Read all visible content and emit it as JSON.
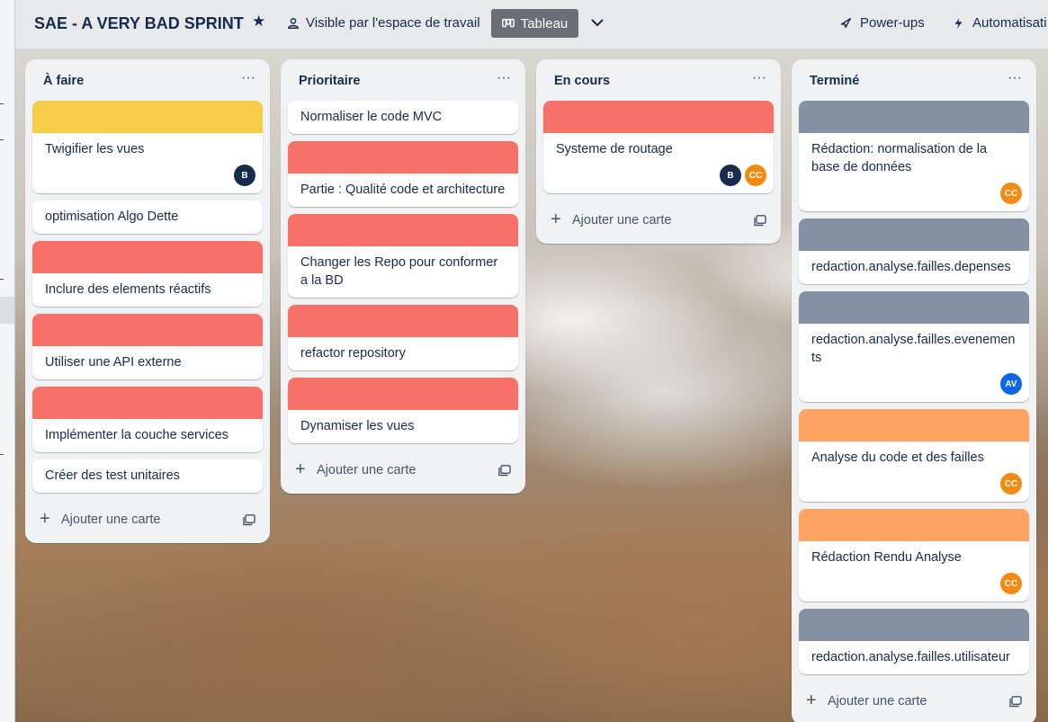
{
  "header": {
    "title": "SAE - A VERY BAD SPRINT",
    "visibility": "Visible par l'espace de travail",
    "view": "Tableau",
    "powerups": "Power-ups",
    "automation": "Automatisati"
  },
  "colors": {
    "yellow": "#f5cd47",
    "red": "#f87168",
    "gray": "#8590a2",
    "orange": "#fea362",
    "avatar_b": "#172b4d",
    "avatar_cc": "#f38a12",
    "avatar_av": "#0c66e4"
  },
  "add_card_label": "Ajouter une carte",
  "lists": [
    {
      "title": "À faire",
      "cards": [
        {
          "title": "Twigifier les vues",
          "cover": "yellow",
          "members": [
            "B"
          ]
        },
        {
          "title": "optimisation Algo Dette",
          "cover": "",
          "members": []
        },
        {
          "title": "Inclure des elements réactifs",
          "cover": "red",
          "members": []
        },
        {
          "title": "Utiliser une API externe",
          "cover": "red",
          "members": []
        },
        {
          "title": "Implémenter la couche services",
          "cover": "red",
          "members": []
        },
        {
          "title": "Créer des test unitaires",
          "cover": "",
          "members": []
        }
      ]
    },
    {
      "title": "Prioritaire",
      "cards": [
        {
          "title": "Normaliser le code MVC",
          "cover": "",
          "members": []
        },
        {
          "title": "Partie : Qualité code et architecture",
          "cover": "red",
          "members": []
        },
        {
          "title": "Changer les Repo pour conformer a la BD",
          "cover": "red",
          "members": []
        },
        {
          "title": "refactor repository",
          "cover": "red",
          "members": []
        },
        {
          "title": "Dynamiser les vues",
          "cover": "red",
          "members": []
        }
      ]
    },
    {
      "title": "En cours",
      "cards": [
        {
          "title": "Systeme de routage",
          "cover": "red",
          "members": [
            "B",
            "CC"
          ]
        }
      ]
    },
    {
      "title": "Terminé",
      "cards": [
        {
          "title": "Rédaction: normalisation de la base de données",
          "cover": "gray",
          "members": [
            "CC"
          ]
        },
        {
          "title": "redaction.analyse.failles.depenses",
          "cover": "gray",
          "members": []
        },
        {
          "title": "redaction.analyse.failles.evenements",
          "cover": "gray",
          "members": [
            "AV"
          ]
        },
        {
          "title": "Analyse du code et des failles",
          "cover": "orange",
          "members": [
            "CC"
          ]
        },
        {
          "title": "Rédaction Rendu Analyse",
          "cover": "orange",
          "members": [
            "CC"
          ]
        },
        {
          "title": "redaction.analyse.failles.utilisateur",
          "cover": "gray",
          "members": []
        }
      ]
    }
  ]
}
